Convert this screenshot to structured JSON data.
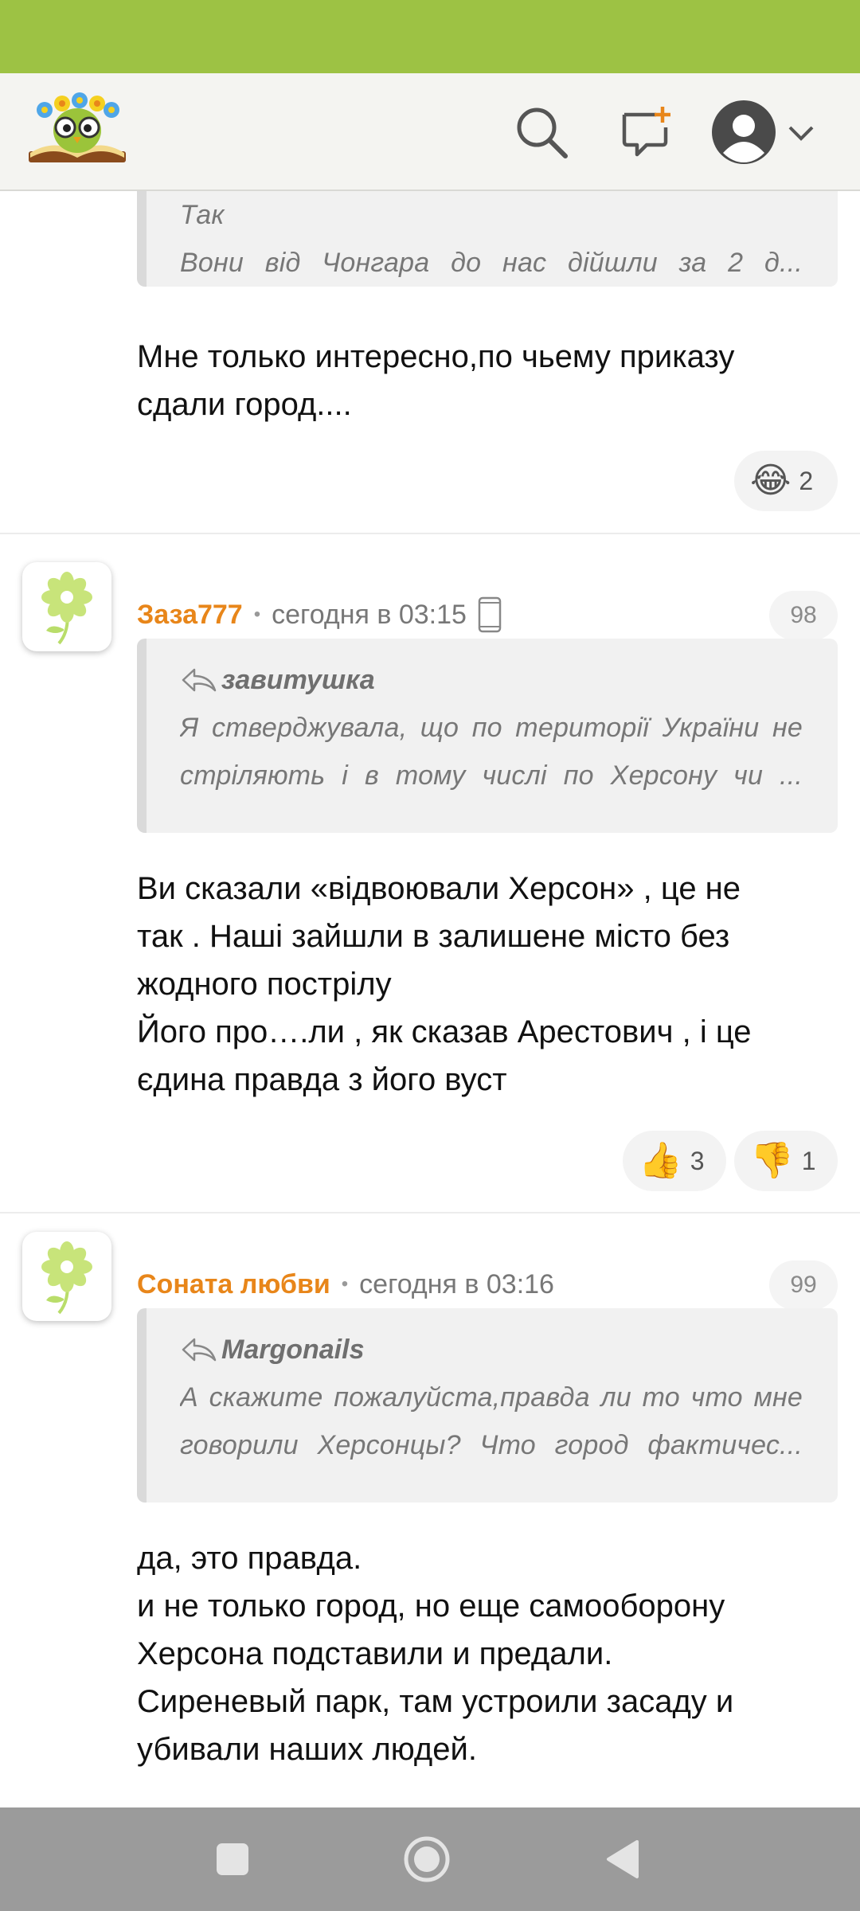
{
  "colors": {
    "status_bar": "#9dc244",
    "author": "#e8861a",
    "header_bg": "#f4f4f1",
    "nav_bar": "#9b9b9b"
  },
  "header": {
    "logo_icon": "owl-book-logo-icon",
    "search_icon": "search-icon",
    "new_post_icon": "new-message-icon",
    "profile_icon": "user-avatar-icon",
    "profile_menu_icon": "chevron-down-icon"
  },
  "comments": [
    {
      "quote": {
        "lines": [
          "Так",
          "Вони  від  Чонгара  до  нас  дійшли  за  2  д..."
        ]
      },
      "text": "Мне только интересно,по чьему приказу\nсдали город....",
      "reactions": [
        {
          "emoji": "😂",
          "icon": "laughing-face-icon",
          "count": "2"
        }
      ]
    },
    {
      "author": "Заза777",
      "time": "сегодня в 03:15",
      "device_icon": "mobile-phone-icon",
      "number": "98",
      "quote": {
        "author": "завитушка",
        "lines": [
          "Я  стверджувала,  що  по  території  України  не",
          "стріляють  і  в  тому  числі  по  Херсону  чи  ..."
        ]
      },
      "text": "Ви сказали «відвоювали Херсон» , це не\nтак . Наші зайшли в залишене місто без\nжодного пострілу\nЙого про….ли , як сказав Арестович , і це\nєдина правда з його вуст",
      "reactions": [
        {
          "emoji": "👍",
          "icon": "thumbs-up-icon",
          "count": "3"
        },
        {
          "emoji": "👎",
          "icon": "thumbs-down-icon",
          "count": "1"
        }
      ]
    },
    {
      "author": "Соната любви",
      "time": "сегодня в 03:16",
      "number": "99",
      "quote": {
        "author": "Margonails",
        "lines": [
          "А  скажите  пожалуйста,правда  ли  то  что  мне",
          "говорили  Херсонцы?  Что  город  фактичес..."
        ]
      },
      "text": "да, это правда.\nи не только город, но еще самооборону\nХерсона подставили и предали.\nСиреневый парк, там устроили засаду и\nубивали наших людей."
    }
  ],
  "nav": {
    "recent_icon": "square-icon",
    "home_icon": "circle-icon",
    "back_icon": "triangle-back-icon"
  }
}
